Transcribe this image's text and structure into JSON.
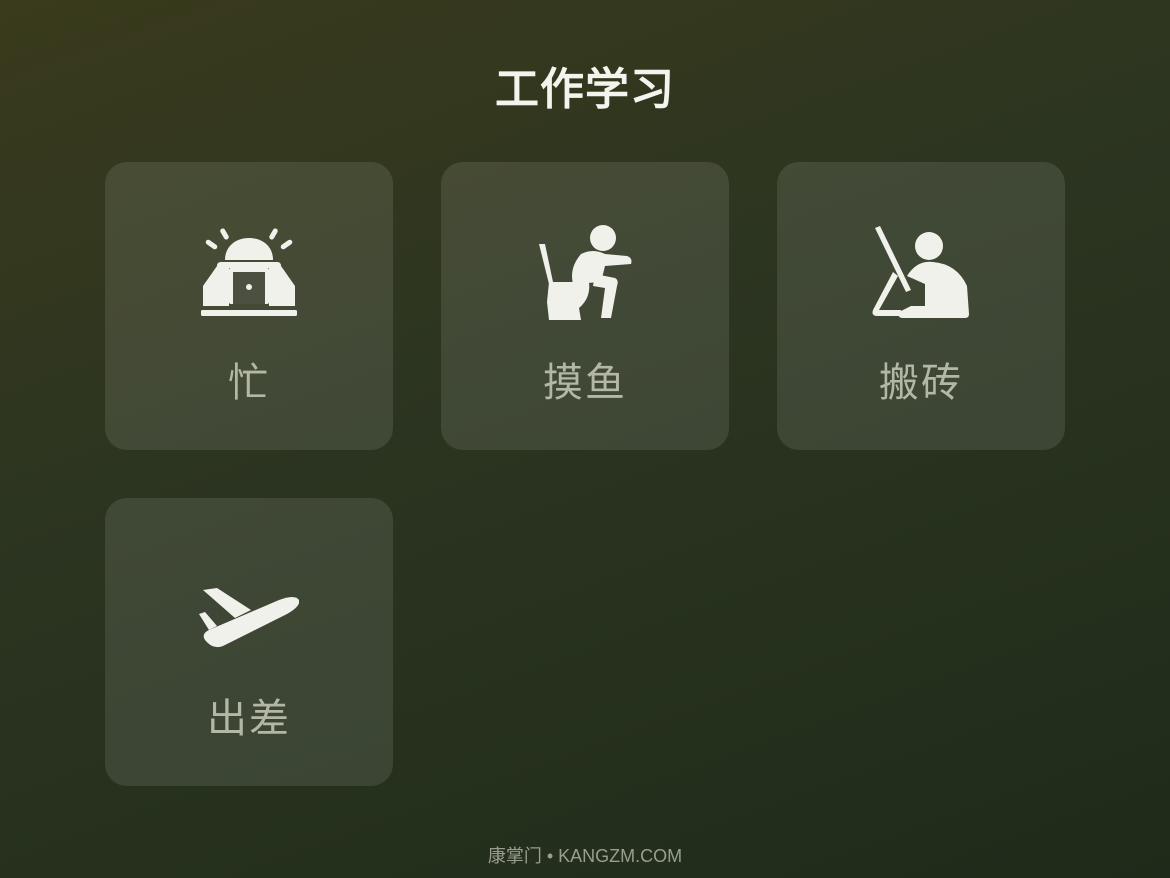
{
  "header": {
    "title": "工作学习"
  },
  "tiles": [
    {
      "label": "忙",
      "icon": "alarm-laptop-icon"
    },
    {
      "label": "摸鱼",
      "icon": "toilet-sitting-icon"
    },
    {
      "label": "搬砖",
      "icon": "desk-work-icon"
    },
    {
      "label": "出差",
      "icon": "airplane-departure-icon"
    }
  ],
  "footer": {
    "text": "康掌门 • KANGZM.COM"
  },
  "colors": {
    "icon": "#f1f1ec",
    "label": "#b3b7a6",
    "tile_bg": "rgba(255,255,255,0.10)"
  }
}
